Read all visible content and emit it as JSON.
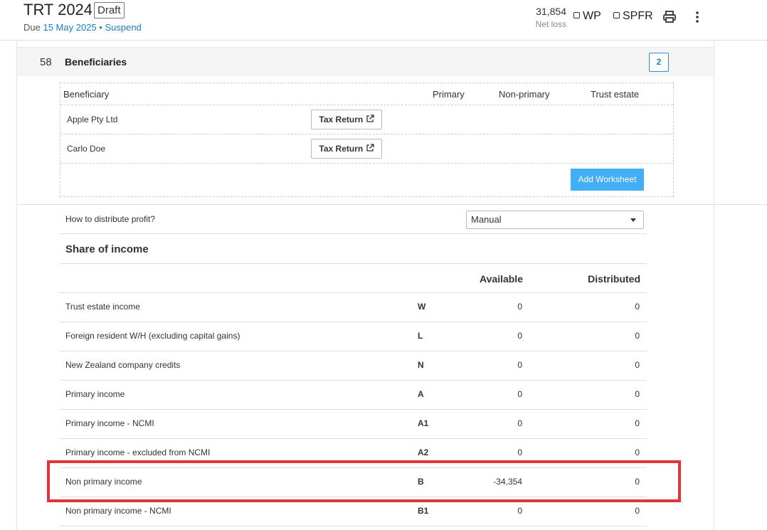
{
  "header": {
    "title": "TRT 2024",
    "status_badge": "Draft",
    "due_prefix": "Due",
    "due_date": "15 May 2025",
    "separator": "•",
    "suspend_link": "Suspend",
    "net_value": "31,854",
    "net_label": "Net loss",
    "wp_label": "WP",
    "spfr_label": "SPFR"
  },
  "section": {
    "number": "58",
    "title": "Beneficiaries",
    "count": "2"
  },
  "beneficiaries": {
    "columns": [
      "Beneficiary",
      "Primary",
      "Non-primary",
      "Trust estate"
    ],
    "rows": [
      {
        "name": "Apple Pty Ltd",
        "button": "Tax Return"
      },
      {
        "name": "Carlo Doe",
        "button": "Tax Return"
      }
    ],
    "add_worksheet": "Add Worksheet"
  },
  "distribution": {
    "label": "How to distribute profit?",
    "selected": "Manual"
  },
  "share": {
    "title": "Share of income",
    "col_available": "Available",
    "col_distributed": "Distributed",
    "rows": [
      {
        "label": "Trust estate income",
        "code": "W",
        "available": "0",
        "distributed": "0"
      },
      {
        "label": "Foreign resident W/H (excluding capital gains)",
        "code": "L",
        "available": "0",
        "distributed": "0"
      },
      {
        "label": "New Zealand company credits",
        "code": "N",
        "available": "0",
        "distributed": "0"
      },
      {
        "label": "Primary income",
        "code": "A",
        "available": "0",
        "distributed": "0"
      },
      {
        "label": "Primary income - NCMI",
        "code": "A1",
        "available": "0",
        "distributed": "0"
      },
      {
        "label": "Primary income - excluded from NCMI",
        "code": "A2",
        "available": "0",
        "distributed": "0"
      },
      {
        "label": "Non primary income",
        "code": "B",
        "available": "-34,354",
        "distributed": "0"
      },
      {
        "label": "Non primary income - NCMI",
        "code": "B1",
        "available": "0",
        "distributed": "0"
      }
    ]
  },
  "colors": {
    "accent": "#1a7ec5",
    "button_primary": "#42aef3",
    "highlight": "#e0343a"
  }
}
